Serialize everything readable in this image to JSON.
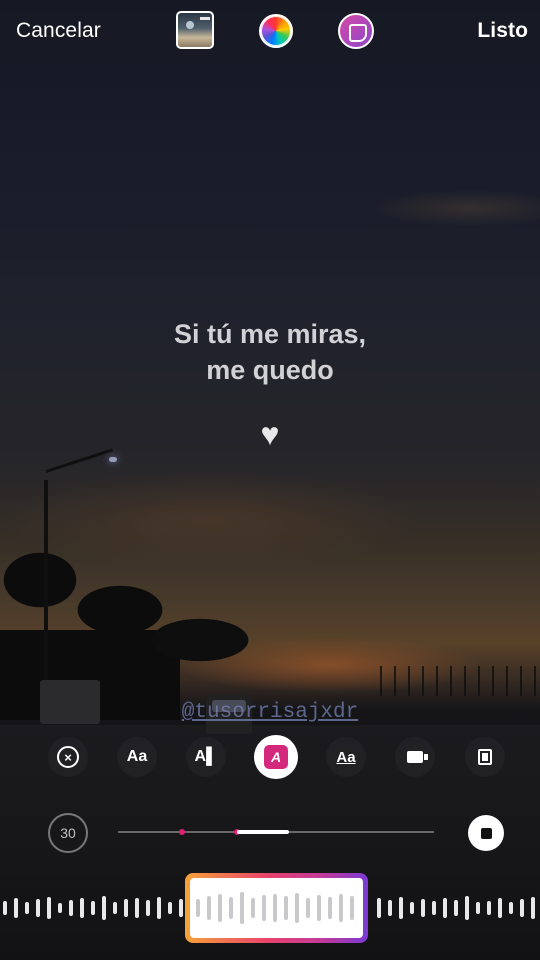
{
  "topbar": {
    "cancel_label": "Cancelar",
    "done_label": "Listo"
  },
  "overlay": {
    "line1": "Si tú me miras,",
    "line2": "me quedo",
    "heart": "♥",
    "mention": "@tusorrisajxdr"
  },
  "toolbar": {
    "remove_symbol": "×",
    "text_size_label": "Aa",
    "text_style_label": "A▌",
    "active_style_label": "A",
    "underline_style_label": "Aa"
  },
  "timer": {
    "duration": "30"
  },
  "colors": {
    "accent_pink": "#d3287c",
    "selection_gradient": [
      "#f7a23a",
      "#e8436b",
      "#c23a9b",
      "#7a3ad4"
    ]
  }
}
